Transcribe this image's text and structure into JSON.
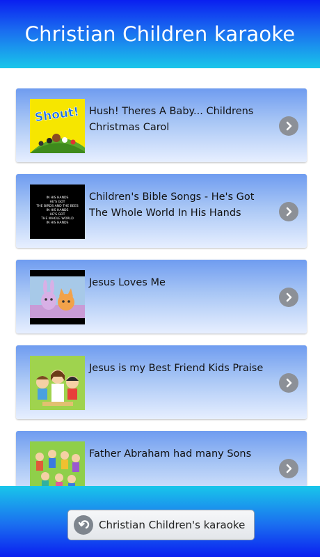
{
  "header": {
    "title": "Christian Children karaoke"
  },
  "items": [
    {
      "title": "Hush! Theres A Baby... Childrens Christmas Carol",
      "thumb_icon": "shout-album-cover-image",
      "thumb_text": "Shout!"
    },
    {
      "title": "Children's Bible Songs - He's Got The Whole World In His Hands",
      "thumb_icon": "lyrics-text-thumbnail",
      "thumb_lines": [
        "IN HIS HANDS",
        "HE'S GOT",
        "THE BIRDS AND THE BEES",
        "IN HIS HANDS",
        "HE'S GOT",
        "THE WHOLE WORLD",
        "IN HIS HANDS"
      ]
    },
    {
      "title": "Jesus Loves Me",
      "thumb_icon": "cartoon-animals-thumbnail"
    },
    {
      "title": "Jesus is my Best Friend Kids Praise",
      "thumb_icon": "cartoon-jesus-kids-thumbnail"
    },
    {
      "title": "Father Abraham had many Sons",
      "thumb_icon": "cartoon-crowd-thumbnail"
    }
  ],
  "footer": {
    "button_label": "Christian Children's karaoke",
    "button_icon": "back-arrow-icon"
  },
  "colors": {
    "header_top": "#0a1ff0",
    "header_bottom": "#19c6ea",
    "item_top": "#6f9cf0",
    "item_bottom": "#e7efff",
    "chevron": "#8c9097"
  }
}
